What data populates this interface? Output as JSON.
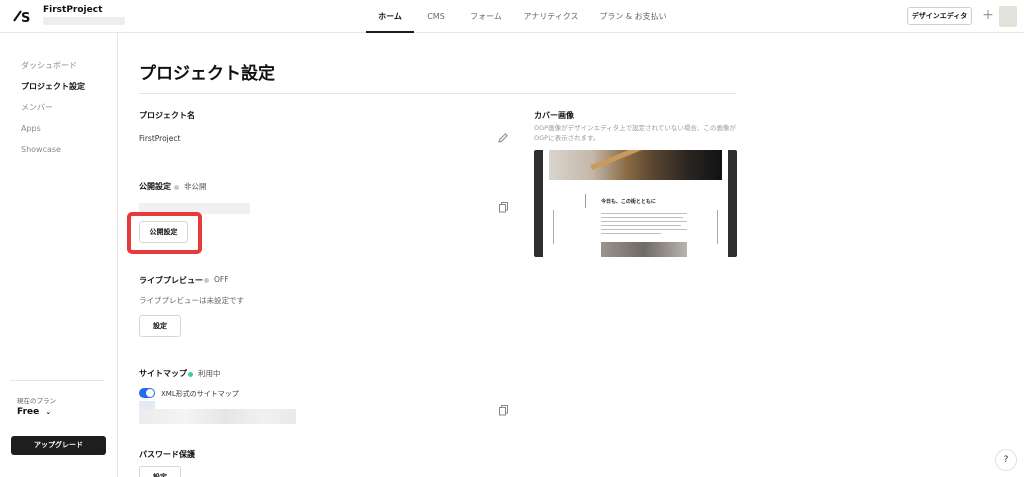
{
  "header": {
    "project_name": "FirstProject",
    "nav": [
      {
        "label": "ホーム",
        "active": true
      },
      {
        "label": "CMS",
        "active": false
      },
      {
        "label": "フォーム",
        "active": false
      },
      {
        "label": "アナリティクス",
        "active": false
      },
      {
        "label": "プラン & お支払い",
        "active": false
      }
    ],
    "design_editor_label": "デザインエディタ",
    "add_icon": "plus-icon"
  },
  "sidebar": {
    "items": [
      {
        "label": "ダッシュボード",
        "active": false
      },
      {
        "label": "プロジェクト設定",
        "active": true
      },
      {
        "label": "メンバー",
        "active": false
      },
      {
        "label": "Apps",
        "active": false
      },
      {
        "label": "Showcase",
        "active": false
      }
    ],
    "plan_label": "現在のプラン",
    "plan_value": "Free",
    "upgrade_label": "アップグレード"
  },
  "main": {
    "title": "プロジェクト設定",
    "project_name_label": "プロジェクト名",
    "project_name_value": "FirstProject",
    "publish": {
      "label": "公開設定",
      "status": "非公開",
      "status_color": "#c8c8c8",
      "button_label": "公開設定"
    },
    "live_preview": {
      "label": "ライブプレビュー",
      "status": "OFF",
      "status_color": "#c8c8c8",
      "description": "ライブプレビューは未設定です",
      "button_label": "設定"
    },
    "sitemap": {
      "label": "サイトマップ",
      "status": "利用中",
      "status_color": "#3ecf8e",
      "toggle_label": "XML形式のサイトマップ",
      "toggle_on": true
    },
    "password": {
      "label": "パスワード保護",
      "button_label": "設定"
    },
    "cover": {
      "label": "カバー画像",
      "description": "OGP画像がデザインエディタ上で設定されていない場合、この画像がOGPに表示されます。",
      "heading": "今日も、この街とともに"
    }
  },
  "help_label": "?",
  "colors": {
    "accent": "#1e6fe8",
    "highlight": "#e8393d",
    "upgrade_bg": "#1e1e1e"
  }
}
